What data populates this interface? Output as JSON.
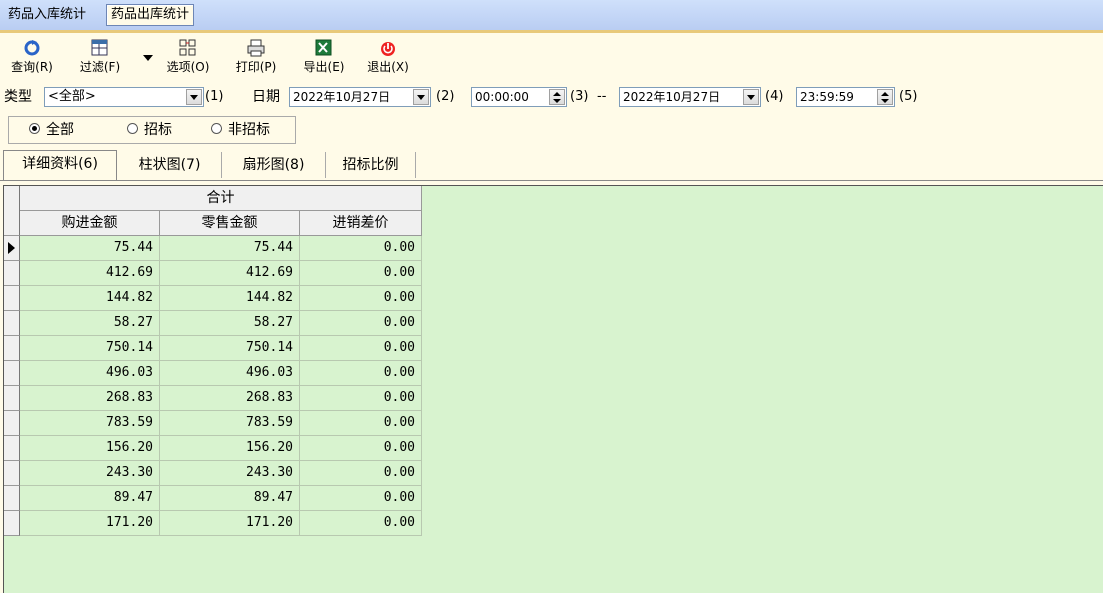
{
  "top_tabs": [
    {
      "label": "药品入库统计",
      "active": false
    },
    {
      "label": "药品出库统计",
      "active": true
    }
  ],
  "toolbar": [
    {
      "label": "查询(R)",
      "icon": "refresh-icon"
    },
    {
      "label": "过滤(F)",
      "icon": "filter-icon"
    },
    {
      "label": "选项(O)",
      "icon": "options-icon"
    },
    {
      "label": "打印(P)",
      "icon": "print-icon"
    },
    {
      "label": "导出(E)",
      "icon": "excel-export-icon"
    },
    {
      "label": "退出(X)",
      "icon": "power-exit-icon"
    }
  ],
  "filters": {
    "type_label": "类型",
    "type_value": "<全部>",
    "hotkey1": "(1)",
    "date_label": "日期",
    "start_date": "2022年10月27日",
    "hotkey2": "(2)",
    "start_time": "00:00:00",
    "hotkey3": "(3)",
    "range_sep": "--",
    "end_date": "2022年10月27日",
    "hotkey4": "(4)",
    "end_time": "23:59:59",
    "hotkey5": "(5)"
  },
  "radios": [
    {
      "label": "全部",
      "selected": true
    },
    {
      "label": "招标",
      "selected": false
    },
    {
      "label": "非招标",
      "selected": false
    }
  ],
  "sub_tabs": [
    {
      "label": "详细资料(6)",
      "active": true
    },
    {
      "label": "柱状图(7)",
      "active": false
    },
    {
      "label": "扇形图(8)",
      "active": false
    },
    {
      "label": "招标比例",
      "active": false
    }
  ],
  "grid": {
    "group_header": "合计",
    "columns": [
      "购进金额",
      "零售金额",
      "进销差价"
    ],
    "rows": [
      [
        "75.44",
        "75.44",
        "0.00"
      ],
      [
        "412.69",
        "412.69",
        "0.00"
      ],
      [
        "144.82",
        "144.82",
        "0.00"
      ],
      [
        "58.27",
        "58.27",
        "0.00"
      ],
      [
        "750.14",
        "750.14",
        "0.00"
      ],
      [
        "496.03",
        "496.03",
        "0.00"
      ],
      [
        "268.83",
        "268.83",
        "0.00"
      ],
      [
        "783.59",
        "783.59",
        "0.00"
      ],
      [
        "156.20",
        "156.20",
        "0.00"
      ],
      [
        "243.30",
        "243.30",
        "0.00"
      ],
      [
        "89.47",
        "89.47",
        "0.00"
      ],
      [
        "171.20",
        "171.20",
        "0.00"
      ]
    ],
    "current_row": 0
  },
  "colors": {
    "grid_bg": "#d8f3cf",
    "panel_bg": "#fffbe8",
    "header_strip": "#c4d7f7"
  }
}
